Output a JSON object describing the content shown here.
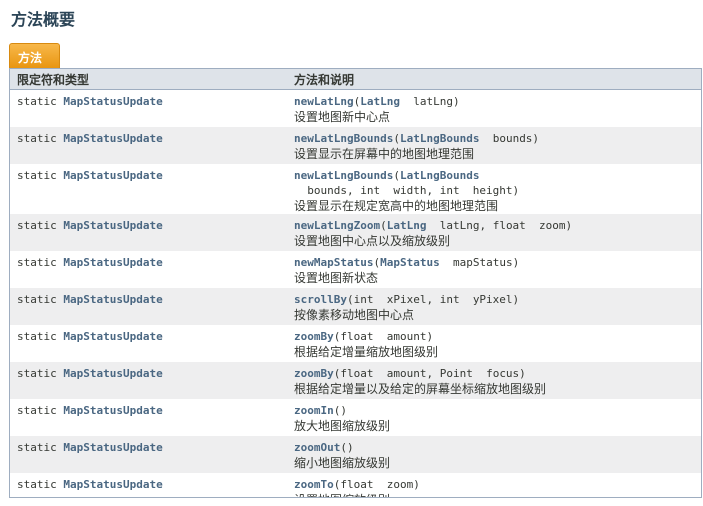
{
  "page": {
    "title": "方法概要",
    "tab": "方法"
  },
  "table": {
    "headers": [
      "限定符和类型",
      "方法和说明"
    ],
    "rows": [
      {
        "modifier": "static ",
        "type": "MapStatusUpdate",
        "method": "newLatLng",
        "sig": "(",
        "ptype": "LatLng",
        "params": "  latLng)",
        "desc": "设置地图新中心点"
      },
      {
        "modifier": "static ",
        "type": "MapStatusUpdate",
        "method": "newLatLngBounds",
        "sig": "(",
        "ptype": "LatLngBounds",
        "params": "  bounds)",
        "desc": "设置显示在屏幕中的地图地理范围"
      },
      {
        "modifier": "static ",
        "type": "MapStatusUpdate",
        "method": "newLatLngBounds",
        "sig": "(",
        "ptype": "LatLngBounds",
        "params": "  bounds, int  width, int  height)",
        "desc": "设置显示在规定宽高中的地图地理范围"
      },
      {
        "modifier": "static ",
        "type": "MapStatusUpdate",
        "method": "newLatLngZoom",
        "sig": "(",
        "ptype": "LatLng",
        "params": "  latLng, float  zoom)",
        "desc": "设置地图中心点以及缩放级别"
      },
      {
        "modifier": "static ",
        "type": "MapStatusUpdate",
        "method": "newMapStatus",
        "sig": "(",
        "ptype": "MapStatus",
        "params": "  mapStatus)",
        "desc": "设置地图新状态"
      },
      {
        "modifier": "static ",
        "type": "MapStatusUpdate",
        "method": "scrollBy",
        "sig": "(int  xPixel, int  yPixel)",
        "ptype": "",
        "params": "",
        "desc": "按像素移动地图中心点"
      },
      {
        "modifier": "static ",
        "type": "MapStatusUpdate",
        "method": "zoomBy",
        "sig": "(float  amount)",
        "ptype": "",
        "params": "",
        "desc": "根据给定增量缩放地图级别"
      },
      {
        "modifier": "static ",
        "type": "MapStatusUpdate",
        "method": "zoomBy",
        "sig": "(float  amount, Point  focus)",
        "ptype": "",
        "params": "",
        "desc": "根据给定增量以及给定的屏幕坐标缩放地图级别"
      },
      {
        "modifier": "static ",
        "type": "MapStatusUpdate",
        "method": "zoomIn",
        "sig": "()",
        "ptype": "",
        "params": "",
        "desc": "放大地图缩放级别"
      },
      {
        "modifier": "static ",
        "type": "MapStatusUpdate",
        "method": "zoomOut",
        "sig": "()",
        "ptype": "",
        "params": "",
        "desc": "缩小地图缩放级别"
      },
      {
        "modifier": "static ",
        "type": "MapStatusUpdate",
        "method": "zoomTo",
        "sig": "(float  zoom)",
        "ptype": "",
        "params": "",
        "desc": "设置地图缩放级别"
      }
    ]
  }
}
